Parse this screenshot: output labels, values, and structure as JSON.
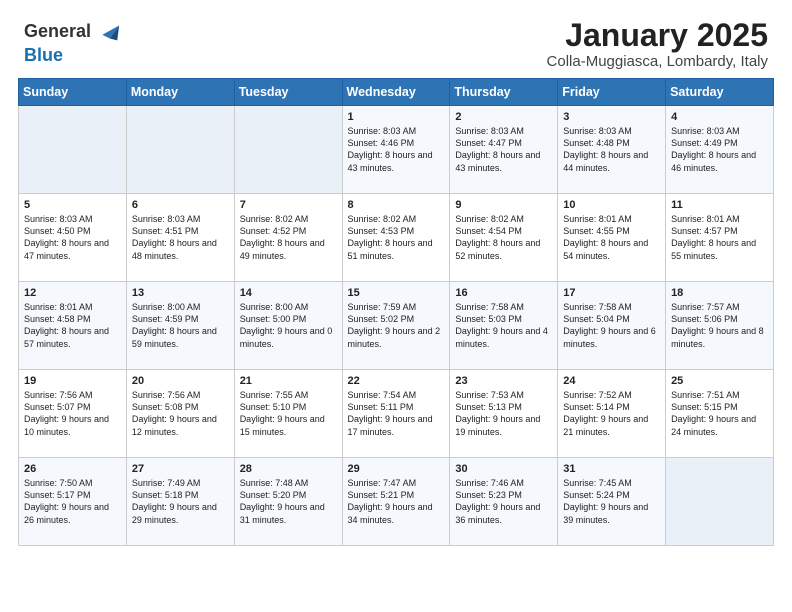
{
  "header": {
    "logo_line1": "General",
    "logo_line2": "Blue",
    "title": "January 2025",
    "subtitle": "Colla-Muggiasca, Lombardy, Italy"
  },
  "weekdays": [
    "Sunday",
    "Monday",
    "Tuesday",
    "Wednesday",
    "Thursday",
    "Friday",
    "Saturday"
  ],
  "weeks": [
    [
      {
        "day": "",
        "info": ""
      },
      {
        "day": "",
        "info": ""
      },
      {
        "day": "",
        "info": ""
      },
      {
        "day": "1",
        "info": "Sunrise: 8:03 AM\nSunset: 4:46 PM\nDaylight: 8 hours and 43 minutes."
      },
      {
        "day": "2",
        "info": "Sunrise: 8:03 AM\nSunset: 4:47 PM\nDaylight: 8 hours and 43 minutes."
      },
      {
        "day": "3",
        "info": "Sunrise: 8:03 AM\nSunset: 4:48 PM\nDaylight: 8 hours and 44 minutes."
      },
      {
        "day": "4",
        "info": "Sunrise: 8:03 AM\nSunset: 4:49 PM\nDaylight: 8 hours and 46 minutes."
      }
    ],
    [
      {
        "day": "5",
        "info": "Sunrise: 8:03 AM\nSunset: 4:50 PM\nDaylight: 8 hours and 47 minutes."
      },
      {
        "day": "6",
        "info": "Sunrise: 8:03 AM\nSunset: 4:51 PM\nDaylight: 8 hours and 48 minutes."
      },
      {
        "day": "7",
        "info": "Sunrise: 8:02 AM\nSunset: 4:52 PM\nDaylight: 8 hours and 49 minutes."
      },
      {
        "day": "8",
        "info": "Sunrise: 8:02 AM\nSunset: 4:53 PM\nDaylight: 8 hours and 51 minutes."
      },
      {
        "day": "9",
        "info": "Sunrise: 8:02 AM\nSunset: 4:54 PM\nDaylight: 8 hours and 52 minutes."
      },
      {
        "day": "10",
        "info": "Sunrise: 8:01 AM\nSunset: 4:55 PM\nDaylight: 8 hours and 54 minutes."
      },
      {
        "day": "11",
        "info": "Sunrise: 8:01 AM\nSunset: 4:57 PM\nDaylight: 8 hours and 55 minutes."
      }
    ],
    [
      {
        "day": "12",
        "info": "Sunrise: 8:01 AM\nSunset: 4:58 PM\nDaylight: 8 hours and 57 minutes."
      },
      {
        "day": "13",
        "info": "Sunrise: 8:00 AM\nSunset: 4:59 PM\nDaylight: 8 hours and 59 minutes."
      },
      {
        "day": "14",
        "info": "Sunrise: 8:00 AM\nSunset: 5:00 PM\nDaylight: 9 hours and 0 minutes."
      },
      {
        "day": "15",
        "info": "Sunrise: 7:59 AM\nSunset: 5:02 PM\nDaylight: 9 hours and 2 minutes."
      },
      {
        "day": "16",
        "info": "Sunrise: 7:58 AM\nSunset: 5:03 PM\nDaylight: 9 hours and 4 minutes."
      },
      {
        "day": "17",
        "info": "Sunrise: 7:58 AM\nSunset: 5:04 PM\nDaylight: 9 hours and 6 minutes."
      },
      {
        "day": "18",
        "info": "Sunrise: 7:57 AM\nSunset: 5:06 PM\nDaylight: 9 hours and 8 minutes."
      }
    ],
    [
      {
        "day": "19",
        "info": "Sunrise: 7:56 AM\nSunset: 5:07 PM\nDaylight: 9 hours and 10 minutes."
      },
      {
        "day": "20",
        "info": "Sunrise: 7:56 AM\nSunset: 5:08 PM\nDaylight: 9 hours and 12 minutes."
      },
      {
        "day": "21",
        "info": "Sunrise: 7:55 AM\nSunset: 5:10 PM\nDaylight: 9 hours and 15 minutes."
      },
      {
        "day": "22",
        "info": "Sunrise: 7:54 AM\nSunset: 5:11 PM\nDaylight: 9 hours and 17 minutes."
      },
      {
        "day": "23",
        "info": "Sunrise: 7:53 AM\nSunset: 5:13 PM\nDaylight: 9 hours and 19 minutes."
      },
      {
        "day": "24",
        "info": "Sunrise: 7:52 AM\nSunset: 5:14 PM\nDaylight: 9 hours and 21 minutes."
      },
      {
        "day": "25",
        "info": "Sunrise: 7:51 AM\nSunset: 5:15 PM\nDaylight: 9 hours and 24 minutes."
      }
    ],
    [
      {
        "day": "26",
        "info": "Sunrise: 7:50 AM\nSunset: 5:17 PM\nDaylight: 9 hours and 26 minutes."
      },
      {
        "day": "27",
        "info": "Sunrise: 7:49 AM\nSunset: 5:18 PM\nDaylight: 9 hours and 29 minutes."
      },
      {
        "day": "28",
        "info": "Sunrise: 7:48 AM\nSunset: 5:20 PM\nDaylight: 9 hours and 31 minutes."
      },
      {
        "day": "29",
        "info": "Sunrise: 7:47 AM\nSunset: 5:21 PM\nDaylight: 9 hours and 34 minutes."
      },
      {
        "day": "30",
        "info": "Sunrise: 7:46 AM\nSunset: 5:23 PM\nDaylight: 9 hours and 36 minutes."
      },
      {
        "day": "31",
        "info": "Sunrise: 7:45 AM\nSunset: 5:24 PM\nDaylight: 9 hours and 39 minutes."
      },
      {
        "day": "",
        "info": ""
      }
    ]
  ]
}
